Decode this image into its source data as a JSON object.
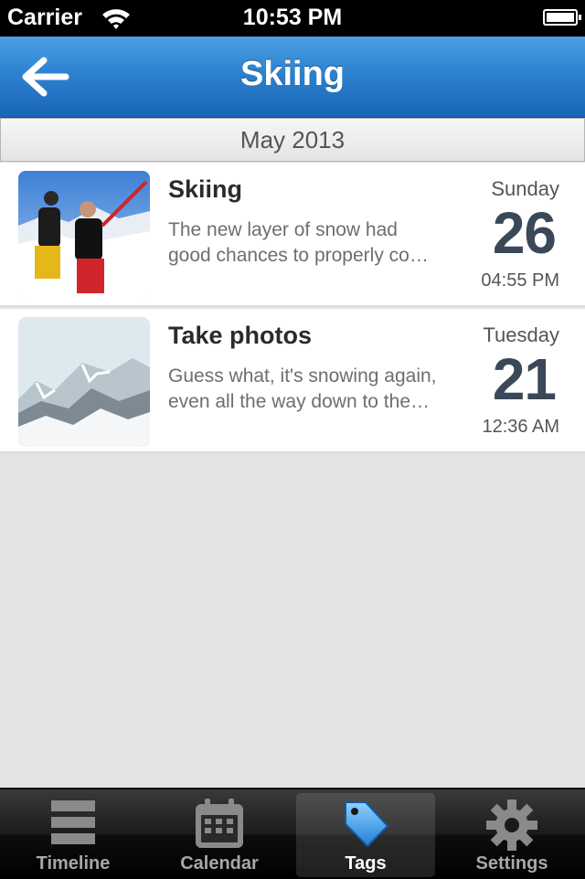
{
  "status_bar": {
    "carrier": "Carrier",
    "time": "10:53 PM",
    "wifi_icon": "wifi-icon",
    "battery_icon": "battery-icon"
  },
  "nav": {
    "title": "Skiing",
    "back_icon": "arrow-left-icon"
  },
  "section": {
    "header": "May 2013"
  },
  "entries": [
    {
      "title": "Skiing",
      "excerpt_line1": "The new layer of snow had",
      "excerpt_line2": "good chances to properly co…",
      "weekday": "Sunday",
      "day": "26",
      "time": "04:55 PM",
      "thumb": "skiers-photo"
    },
    {
      "title": "Take photos",
      "excerpt_line1": "Guess what, it's snowing again,",
      "excerpt_line2": "even all the way down to the…",
      "weekday": "Tuesday",
      "day": "21",
      "time": "12:36 AM",
      "thumb": "snowy-mountains-photo"
    }
  ],
  "tabs": [
    {
      "label": "Timeline",
      "icon": "timeline-icon",
      "selected": false
    },
    {
      "label": "Calendar",
      "icon": "calendar-icon",
      "selected": false
    },
    {
      "label": "Tags",
      "icon": "tag-icon",
      "selected": true
    },
    {
      "label": "Settings",
      "icon": "gear-icon",
      "selected": false
    }
  ],
  "colors": {
    "nav_blue": "#2d82d0",
    "day_number": "#3a4858",
    "background": "#e3e3e3"
  }
}
